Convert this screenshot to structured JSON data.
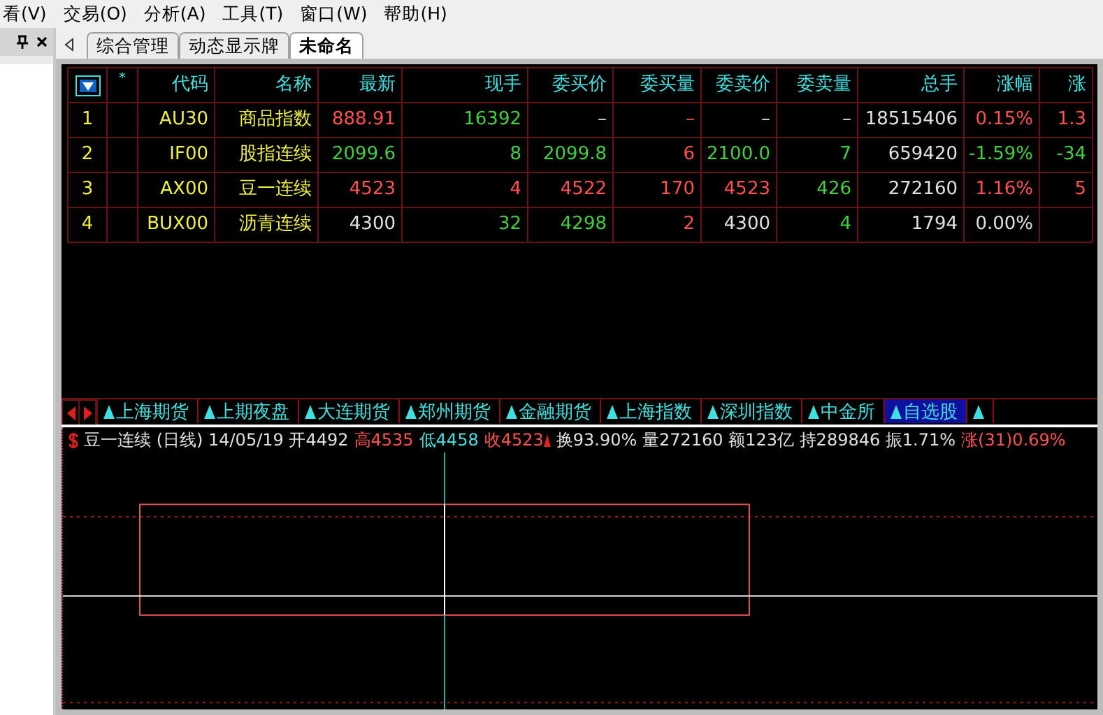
{
  "menu": [
    "看(V)",
    "交易(O)",
    "分析(A)",
    "工具(T)",
    "窗口(W)",
    "帮助(H)"
  ],
  "tabs": [
    {
      "label": "综合管理",
      "selected": false
    },
    {
      "label": "动态显示牌",
      "selected": false
    },
    {
      "label": "未命名",
      "selected": true
    }
  ],
  "table": {
    "columns": [
      "*",
      "代码",
      "名称",
      "最新",
      "现手",
      "委买价",
      "委买量",
      "委卖价",
      "委卖量",
      "总手",
      "涨幅",
      "涨"
    ],
    "rows": [
      {
        "index": "1",
        "cells": [
          {
            "text": ""
          },
          {
            "text": "AU30",
            "color": "#f0f040"
          },
          {
            "text": "商品指数",
            "color": "#f0f040"
          },
          {
            "text": "888.91",
            "color": "#ff5050"
          },
          {
            "text": "16392",
            "color": "#40d040"
          },
          {
            "text": "–",
            "color": "#e0e0e0"
          },
          {
            "text": "–",
            "color": "#ff5050"
          },
          {
            "text": "–",
            "color": "#e0e0e0"
          },
          {
            "text": "–",
            "color": "#e0e0e0"
          },
          {
            "text": "18515406",
            "color": "#e0e0e0"
          },
          {
            "text": "0.15%",
            "color": "#ff5050"
          },
          {
            "text": "1.3",
            "color": "#ff5050"
          }
        ]
      },
      {
        "index": "2",
        "cells": [
          {
            "text": ""
          },
          {
            "text": "IF00",
            "color": "#f0f040"
          },
          {
            "text": "股指连续",
            "color": "#f0f040"
          },
          {
            "text": "2099.6",
            "color": "#40d040"
          },
          {
            "text": "8",
            "color": "#40d040"
          },
          {
            "text": "2099.8",
            "color": "#40d040"
          },
          {
            "text": "6",
            "color": "#ff5050"
          },
          {
            "text": "2100.0",
            "color": "#40d040"
          },
          {
            "text": "7",
            "color": "#40d040"
          },
          {
            "text": "659420",
            "color": "#e0e0e0"
          },
          {
            "text": "-1.59%",
            "color": "#40d040"
          },
          {
            "text": "-34",
            "color": "#40d040"
          }
        ]
      },
      {
        "index": "3",
        "cells": [
          {
            "text": ""
          },
          {
            "text": "AX00",
            "color": "#f0f040"
          },
          {
            "text": "豆一连续",
            "color": "#f0f040"
          },
          {
            "text": "4523",
            "color": "#ff5050"
          },
          {
            "text": "4",
            "color": "#ff5050"
          },
          {
            "text": "4522",
            "color": "#ff5050"
          },
          {
            "text": "170",
            "color": "#ff5050"
          },
          {
            "text": "4523",
            "color": "#ff5050"
          },
          {
            "text": "426",
            "color": "#40d040"
          },
          {
            "text": "272160",
            "color": "#e0e0e0"
          },
          {
            "text": "1.16%",
            "color": "#ff5050"
          },
          {
            "text": "5",
            "color": "#ff5050"
          }
        ]
      },
      {
        "index": "4",
        "cells": [
          {
            "text": ""
          },
          {
            "text": "BUX00",
            "color": "#f0f040"
          },
          {
            "text": "沥青连续",
            "color": "#f0f040"
          },
          {
            "text": "4300",
            "color": "#e0e0e0"
          },
          {
            "text": "32",
            "color": "#40d040"
          },
          {
            "text": "4298",
            "color": "#40d040"
          },
          {
            "text": "2",
            "color": "#ff5050"
          },
          {
            "text": "4300",
            "color": "#e0e0e0"
          },
          {
            "text": "4",
            "color": "#40d040"
          },
          {
            "text": "1794",
            "color": "#e0e0e0"
          },
          {
            "text": "0.00%",
            "color": "#e0e0e0"
          }
        ]
      }
    ]
  },
  "sectors": [
    {
      "label": "上海期货",
      "selected": false
    },
    {
      "label": "上期夜盘",
      "selected": false
    },
    {
      "label": "大连期货",
      "selected": false
    },
    {
      "label": "郑州期货",
      "selected": false
    },
    {
      "label": "金融期货",
      "selected": false
    },
    {
      "label": "上海指数",
      "selected": false
    },
    {
      "label": "深圳指数",
      "selected": false
    },
    {
      "label": "中金所",
      "selected": false
    },
    {
      "label": "自选股",
      "selected": true
    }
  ],
  "chart_info": [
    {
      "text": "豆一连续 (日线) 14/05/19 开4492",
      "color": "#e0e0e0"
    },
    {
      "text": "高4535",
      "color": "#ff5050"
    },
    {
      "text": "低4458",
      "color": "#40e0e0"
    },
    {
      "text": "收4523",
      "color": "#ff5050",
      "arrow": true
    },
    {
      "text": "换93.90% 量272160 额123亿 持289846 振1.71%",
      "color": "#e0e0e0"
    },
    {
      "text": "涨(31)0.69%",
      "color": "#ff5050"
    }
  ]
}
